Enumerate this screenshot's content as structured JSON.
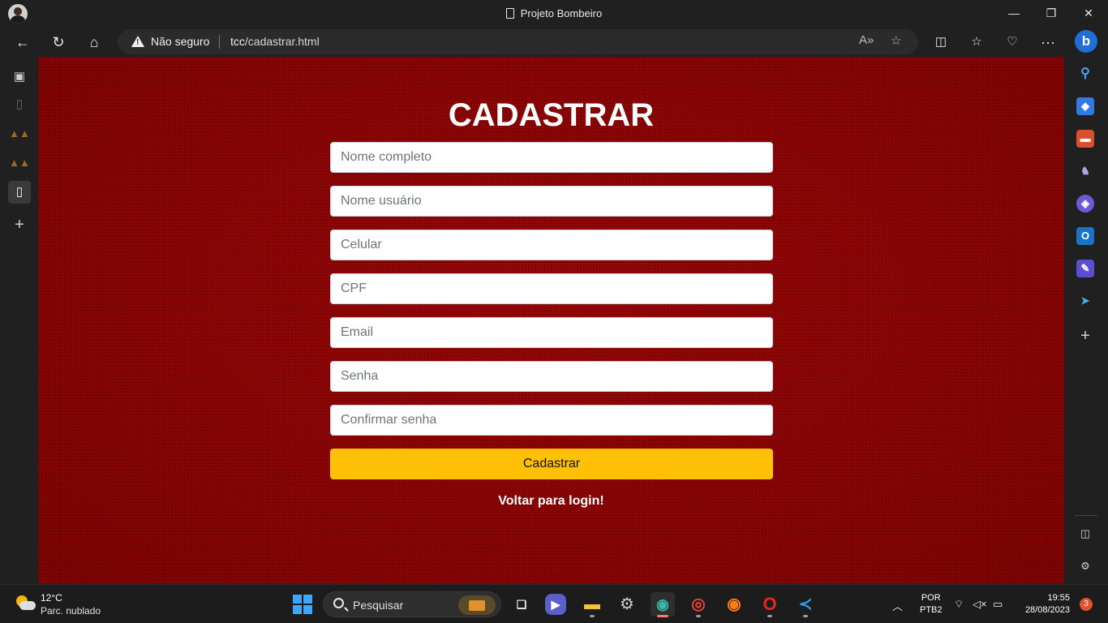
{
  "browser": {
    "window_title": "Projeto Bombeiro",
    "security_label": "Não seguro",
    "url_host": "tcc",
    "url_path": "/cadastrar.html"
  },
  "page": {
    "heading": "CADASTRAR",
    "fields": {
      "nome_completo": "Nome completo",
      "nome_usuario": "Nome usuário",
      "celular": "Celular",
      "cpf": "CPF",
      "email": "Email",
      "senha": "Senha",
      "confirmar_senha": "Confirmar senha"
    },
    "submit_label": "Cadastrar",
    "back_link": "Voltar para login!",
    "colors": {
      "background": "#8a0404",
      "button": "#ffc107",
      "heading": "#ffffff"
    }
  },
  "taskbar": {
    "weather_temp": "12°C",
    "weather_desc": "Parc. nublado",
    "search_label": "Pesquisar",
    "lang_line1": "POR",
    "lang_line2": "PTB2",
    "time": "19:55",
    "date": "28/08/2023",
    "notification_count": "3"
  }
}
